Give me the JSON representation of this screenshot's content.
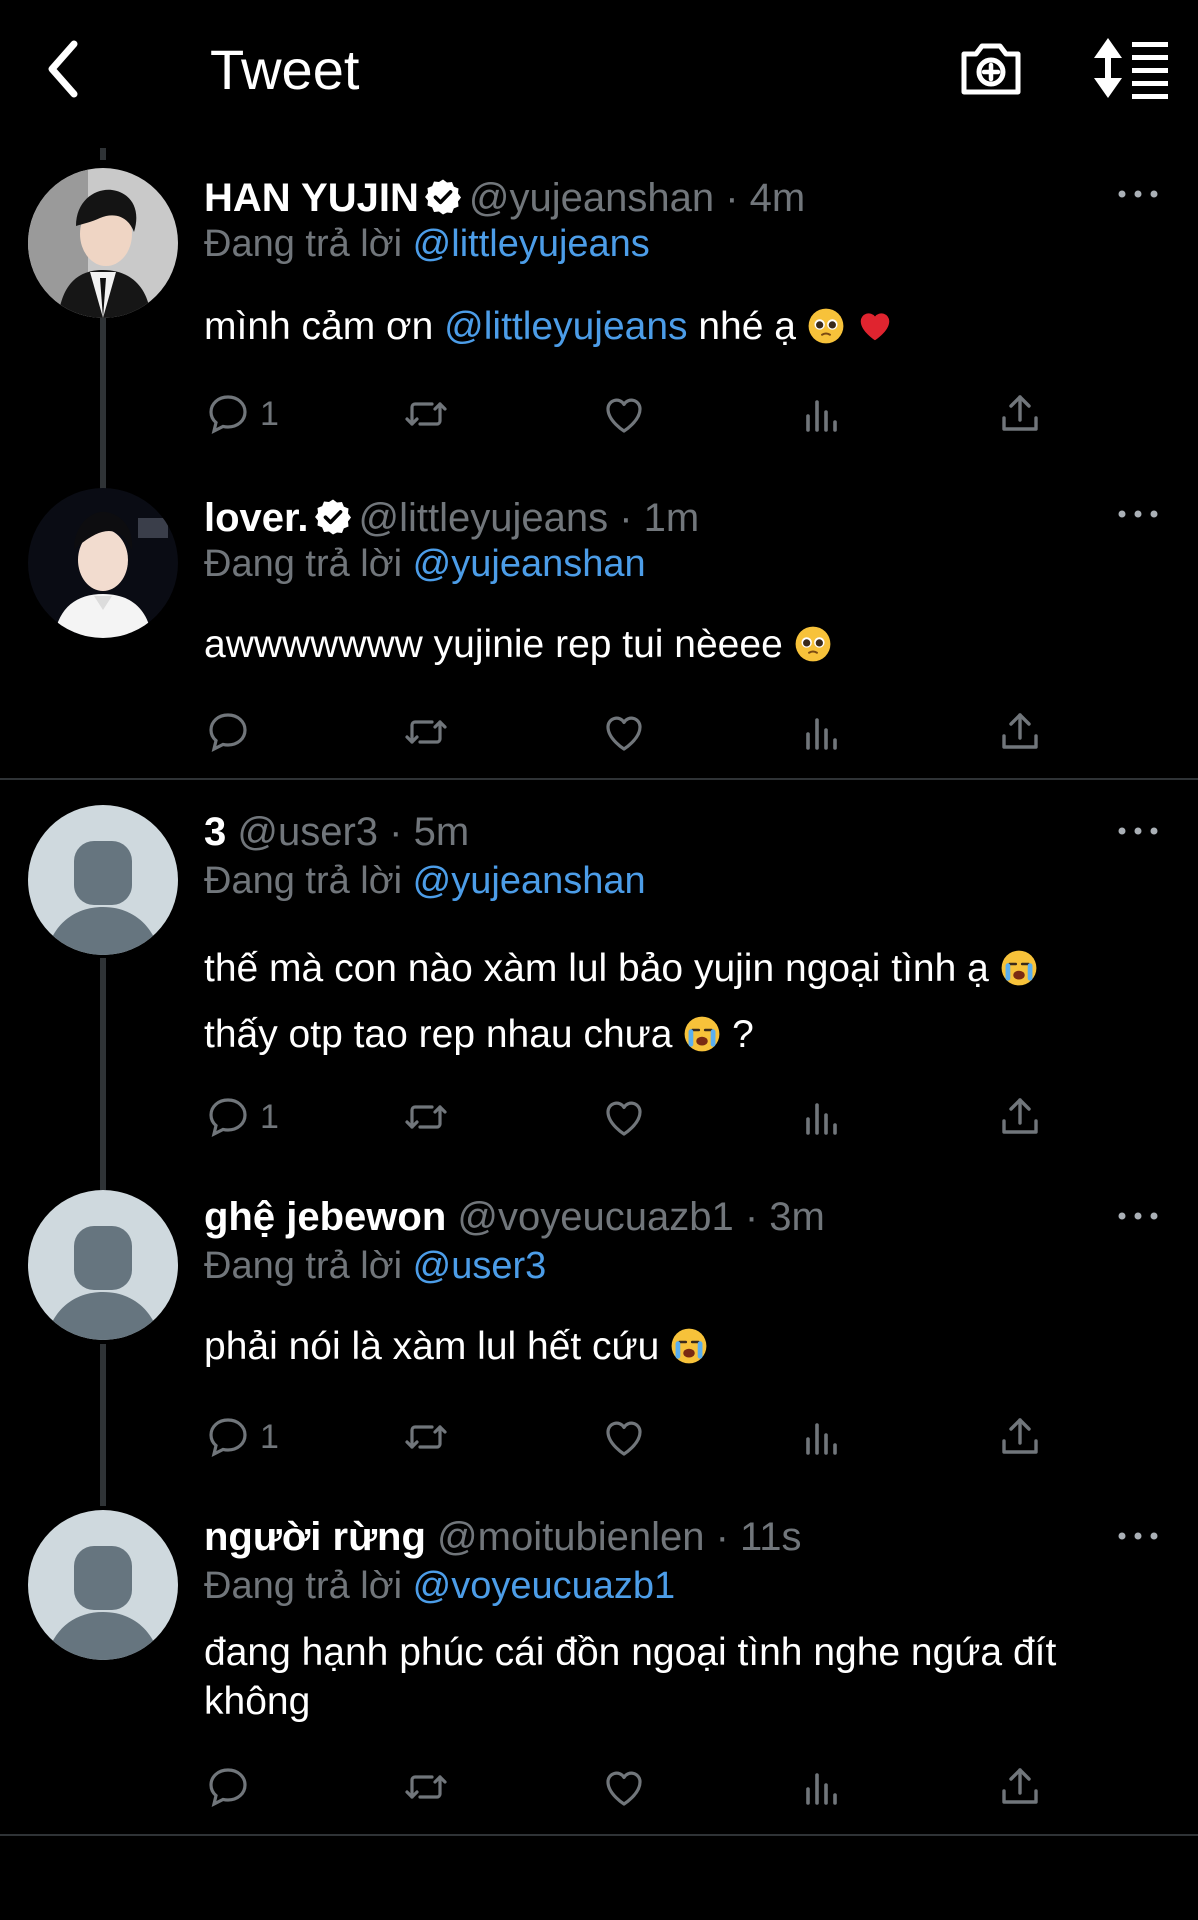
{
  "header": {
    "title": "Tweet"
  },
  "reply_prefix": "Đang trả lời",
  "tweets": [
    {
      "name": "HAN YUJIN",
      "handle": "@yujeanshan",
      "time": "· 4m",
      "reply_to": "@littleyujeans",
      "text_a": "mình cảm ơn ",
      "text_mention": "@littleyujeans",
      "text_b": " nhé ạ",
      "reply_count": "1"
    },
    {
      "name": "lover.",
      "handle": "@littleyujeans",
      "time": "· 1m",
      "reply_to": "@yujeanshan",
      "text_a": "awwwwwww yujinie rep tui nèeee",
      "reply_count": ""
    },
    {
      "name": "3",
      "handle": "@user3",
      "time": "· 5m",
      "reply_to": "@yujeanshan",
      "text_a": "thế mà con nào xàm lul bảo yujin ngoại tình ạ",
      "text_b": "thấy otp tao rep nhau chưa",
      "text_c": "?",
      "reply_count": "1"
    },
    {
      "name": "ghệ jebewon",
      "handle": "@voyeucuazb1",
      "time": "· 3m",
      "reply_to": "@user3",
      "text_a": "phải nói là xàm lul hết cứu",
      "reply_count": "1"
    },
    {
      "name": "người rừng",
      "handle": "@moitubienlen",
      "time": "· 11s",
      "reply_to": "@voyeucuazb1",
      "text_a": "đang hạnh phúc cái đồn ngoại tình nghe ngứa đít không",
      "reply_count": ""
    }
  ],
  "colors": {
    "background": "#000000",
    "link": "#4c9de8",
    "muted": "#71767b",
    "verified": "#ffffff"
  },
  "icons": [
    "back-icon",
    "camera-plus-icon",
    "sort-icon",
    "verified-icon",
    "more-icon",
    "reply-icon",
    "retweet-icon",
    "like-icon",
    "views-icon",
    "share-icon"
  ]
}
